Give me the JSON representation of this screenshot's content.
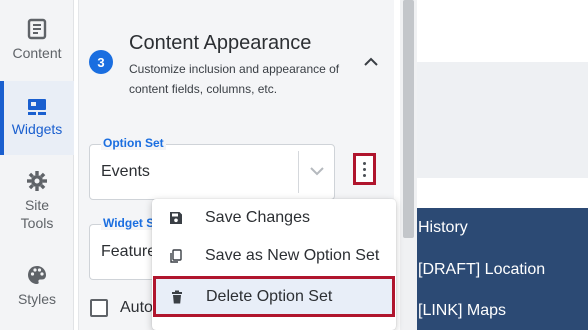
{
  "rail": {
    "items": [
      {
        "label": "Content",
        "icon": "content-icon"
      },
      {
        "label": "Widgets",
        "icon": "widgets-icon"
      },
      {
        "label": "Site\nTools",
        "icon": "gear-icon"
      },
      {
        "label": "Styles",
        "icon": "palette-icon"
      }
    ]
  },
  "section": {
    "step": "3",
    "title": "Content Appearance",
    "description": "Customize inclusion and appearance of content fields, columns, etc."
  },
  "option_set": {
    "legend": "Option Set",
    "value": "Events"
  },
  "widget_style": {
    "legend": "Widget S",
    "value": "Feature"
  },
  "auto_checkbox": {
    "label": "Auto"
  },
  "menu": {
    "items": [
      {
        "label": "Save Changes",
        "icon": "save-icon"
      },
      {
        "label": "Save as New Option Set",
        "icon": "copy-icon"
      },
      {
        "label": "Delete Option Set",
        "icon": "trash-icon"
      }
    ]
  },
  "preview": {
    "links": [
      "History",
      "[DRAFT] Location",
      "[LINK] Maps"
    ]
  },
  "colors": {
    "accent": "#1a6ee0",
    "highlight_border": "#b0152d",
    "preview_navy": "#2c4a74"
  }
}
